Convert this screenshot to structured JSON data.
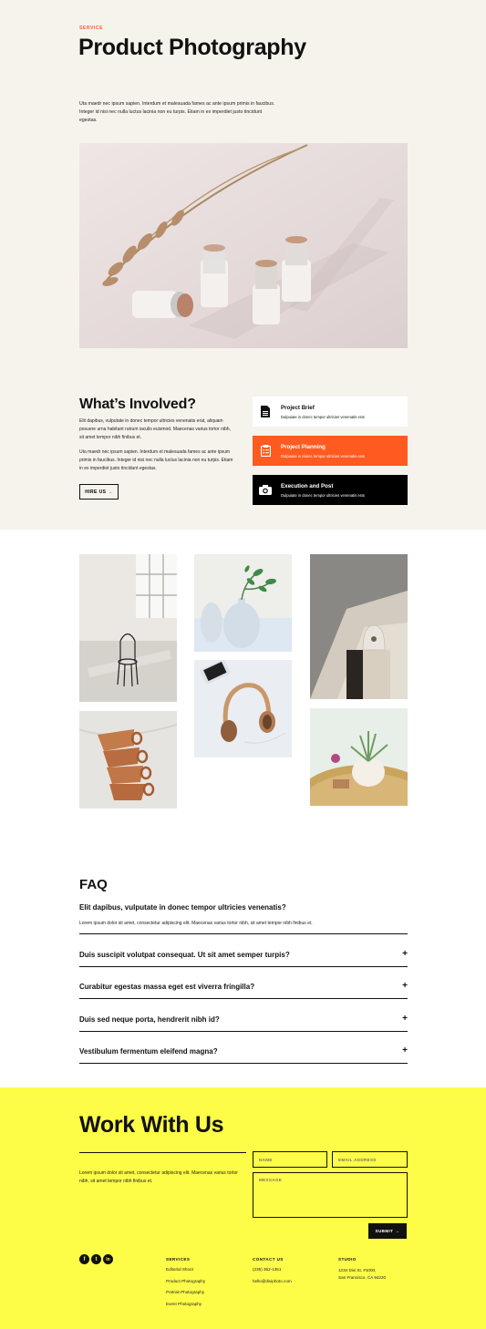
{
  "hero": {
    "eyebrow": "SERVICE",
    "title": "Product Photography",
    "intro": "Utа maedr nec ipsum sapien. Interdum et malesuada fames ac ante ipsum primis in faucibus. Integer id nisi nec nulla luctus lacinia non eu turpis. Etiam in ex imperdiet justo tincidunt egestas."
  },
  "involved": {
    "title": "What’s Involved?",
    "p1": "Elit dapibus, vulputate in donec tempor ultricies venenatis erat, aliquam posuere urna habitant rutrum iaculis euismod. Maecenas varius tortor nibh, sit amet tempor nibh finibus et.",
    "p2": "Uta maedr nec ipsum sapien. Interdum et malesuada fames ac ante ipsum primis in faucibus. Integer id nisi nec nulla luctus lacinia non eu turpis. Etiam in ex imperdiet justo tincidunt egestas.",
    "hire_label": "HIRE US",
    "cards": [
      {
        "title": "Project Brief",
        "sub": "Dulpuiate in donec tempor ultricies venenatis erat",
        "icon": "document-icon"
      },
      {
        "title": "Project Planning",
        "sub": "Dulpuiate in donec tempor ultricies venenatis erat",
        "icon": "checklist-icon"
      },
      {
        "title": "Execution and Post",
        "sub": "Dulpuiate in donec tempor ultricies venenatis erat",
        "icon": "camera-icon"
      }
    ]
  },
  "faq": {
    "title": "FAQ",
    "open_question": "Elit dapibus, vulputate in donec tempor ultricies venenatis?",
    "open_answer": "Lorem ipsum dolor sit amet, consectetur adipiscing elit. Maecenas varius tortor nibh, sit amet tempor nibh finibus et.",
    "questions": [
      "Duis suscipit volutpat consequat. Ut sit amet semper turpis?",
      "Curabitur egestas massa eget est viverra fringilla?",
      "Duis sed neque porta, hendrerit nibh id?",
      "Vestibulum fermentum eleifend magna?"
    ],
    "expand_symbol": "+"
  },
  "work": {
    "title": "Work With Us",
    "text": "Lorem ipsum dolor sit amet, consectetur adipiscing elit. Maecenas varius tortor nibh, sit amet tempor nibh finibus et.",
    "name_placeholder": "NAME",
    "email_placeholder": "EMAIL ADDRESS",
    "message_placeholder": "MESSAGE",
    "submit_label": "SUBMIT"
  },
  "footer": {
    "social": [
      {
        "letter": "f",
        "icon": "facebook-icon"
      },
      {
        "letter": "t",
        "icon": "twitter-icon"
      },
      {
        "letter": "in",
        "icon": "linkedin-icon"
      }
    ],
    "services_heading": "SERVICES",
    "services": [
      "Editorial Shoot",
      "Product Photography",
      "Portrait Photography",
      "Event Photography"
    ],
    "contact_heading": "CONTACT US",
    "phone": "(235) 362-1351",
    "email": "hello@diviphoto.com",
    "studio_heading": "STUDIO",
    "address_line1": "1234 Divi St. #1000,",
    "address_line2": "San Francisco, CA 94220"
  },
  "colors": {
    "hero_bg": "#f6f3ed",
    "accent_orange": "#ff5a1f",
    "work_bg": "#fdfc47"
  }
}
